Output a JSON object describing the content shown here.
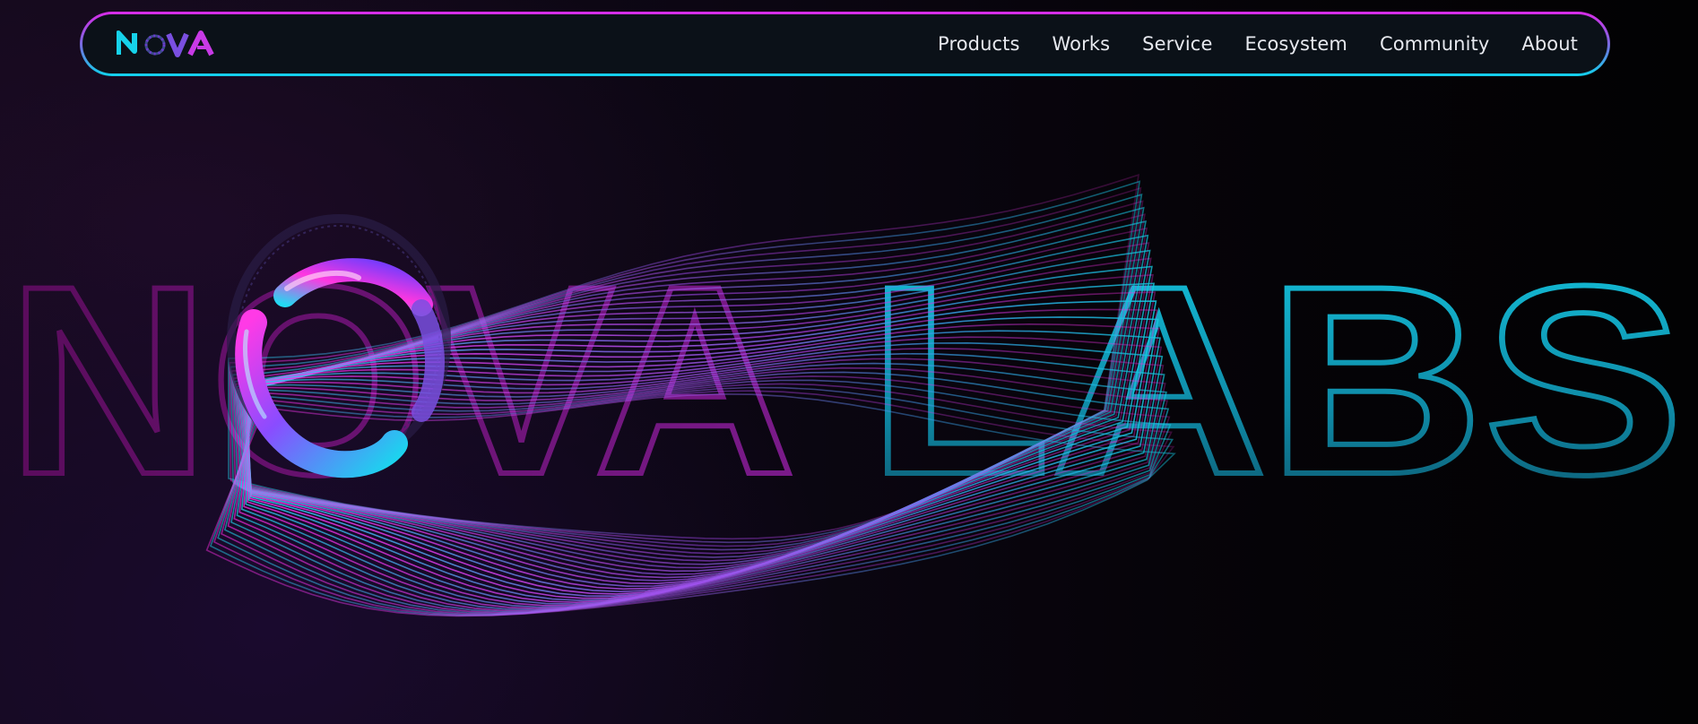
{
  "brand": {
    "logo_text": "NOVA",
    "colors": {
      "pink": "#e62ce8",
      "cyan": "#12cbe6",
      "violet": "#7a4fe0",
      "nav_bg": "#0b1118"
    }
  },
  "nav": {
    "links": [
      "Products",
      "Works",
      "Service",
      "Ecosystem",
      "Community",
      "About"
    ]
  },
  "hero": {
    "title_left": "NOVA",
    "title_right": "LABS",
    "icons": [
      "ring-torus-icon",
      "wave-mesh-graphic"
    ]
  }
}
